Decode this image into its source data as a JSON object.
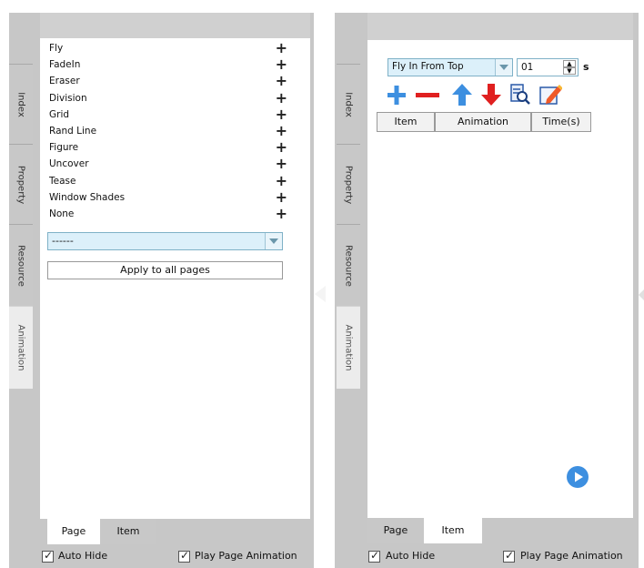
{
  "left_panel": {
    "side_tabs": [
      {
        "label": "Index"
      },
      {
        "label": "Property"
      },
      {
        "label": "Resource"
      },
      {
        "label": "Animation"
      }
    ],
    "effects": [
      {
        "label": "Fly"
      },
      {
        "label": "FadeIn"
      },
      {
        "label": "Eraser"
      },
      {
        "label": "Division"
      },
      {
        "label": "Grid"
      },
      {
        "label": "Rand Line"
      },
      {
        "label": "Figure"
      },
      {
        "label": "Uncover"
      },
      {
        "label": "Tease"
      },
      {
        "label": "Window Shades"
      },
      {
        "label": "None"
      }
    ],
    "add_symbol": "+",
    "direction_select": {
      "value": "------"
    },
    "apply_button": "Apply to all pages",
    "bottom_tabs": [
      {
        "label": "Page"
      },
      {
        "label": "Item"
      }
    ],
    "active_bottom_tab": "Page",
    "auto_hide": {
      "label": "Auto Hide",
      "checked": true
    },
    "play_anim": {
      "label": "Play Page Animation",
      "checked": true
    }
  },
  "right_panel": {
    "side_tabs": [
      {
        "label": "Index"
      },
      {
        "label": "Property"
      },
      {
        "label": "Resource"
      },
      {
        "label": "Animation"
      }
    ],
    "animation_select": {
      "value": "Fly In From Top"
    },
    "time_value": "01",
    "time_unit": "s",
    "toolbar": {
      "add_icon": "plus-icon",
      "remove_icon": "minus-icon",
      "up_icon": "arrow-up-icon",
      "down_icon": "arrow-down-icon",
      "preview_icon": "document-search-icon",
      "edit_icon": "edit-icon"
    },
    "table_headers": [
      "Item",
      "Animation",
      "Time(s)"
    ],
    "bottom_tabs": [
      {
        "label": "Page"
      },
      {
        "label": "Item"
      }
    ],
    "active_bottom_tab": "Item",
    "auto_hide": {
      "label": "Auto Hide",
      "checked": true
    },
    "play_anim": {
      "label": "Play Page Animation",
      "checked": true
    }
  },
  "colors": {
    "panel_gray": "#c7c7c7",
    "icon_blue": "#3d8fe0",
    "icon_red": "#e02020",
    "combo_bg": "#dcf0fa"
  }
}
